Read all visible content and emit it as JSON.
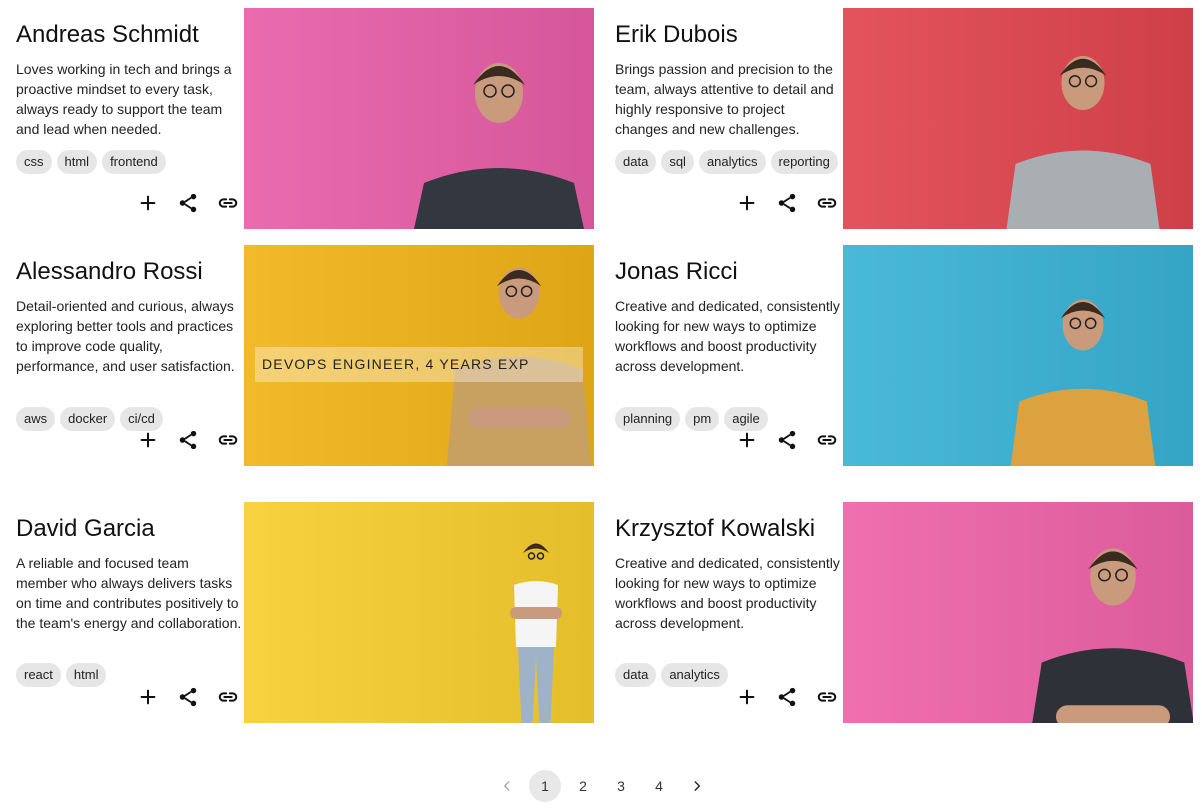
{
  "profiles": [
    {
      "name": "Andreas Schmidt",
      "description": "Loves working in tech and brings a proactive mindset to every task, always ready to support the team and lead when needed.",
      "tags": [
        "css",
        "html",
        "frontend"
      ],
      "bg_color": "#e85fa8",
      "shirt_color": "#333840",
      "overlay": ""
    },
    {
      "name": "Erik Dubois",
      "description": "Brings passion and precision to the team, always attentive to detail and highly responsive to project changes and new challenges.",
      "tags": [
        "data",
        "sql",
        "analytics",
        "reporting"
      ],
      "bg_color": "#e0454e",
      "shirt_color": "#a9aeb3",
      "overlay": ""
    },
    {
      "name": "Alessandro Rossi",
      "description": "Detail-oriented and curious, always exploring better tools and practices to improve code quality, performance, and user satisfaction.",
      "tags": [
        "aws",
        "docker",
        "ci/cd"
      ],
      "bg_color": "#f1b418",
      "shirt_color": "#c8a060",
      "overlay": "DEVOPS ENGINEER, 4 YEARS EXP"
    },
    {
      "name": "Jonas Ricci",
      "description": "Creative and dedicated, consistently looking for new ways to optimize workflows and boost productivity across development.",
      "tags": [
        "planning",
        "pm",
        "agile"
      ],
      "bg_color": "#3ab3d6",
      "shirt_color": "#dba23f",
      "overlay": ""
    },
    {
      "name": "David Garcia",
      "description": "A reliable and focused team member who always delivers tasks on time and contributes positively to the team's energy and collaboration.",
      "tags": [
        "react",
        "html"
      ],
      "bg_color": "#f8cf2e",
      "shirt_color": "#f5f5f5",
      "overlay": ""
    },
    {
      "name": "Krzysztof Kowalski",
      "description": "Creative and dedicated, consistently looking for new ways to optimize workflows and boost productivity across development.",
      "tags": [
        "data",
        "analytics"
      ],
      "bg_color": "#ef63a8",
      "shirt_color": "#2e3238",
      "overlay": ""
    }
  ],
  "actions": {
    "add_icon": "plus-icon",
    "share_icon": "share-icon",
    "link_icon": "link-icon"
  },
  "pagination": {
    "prev_icon": "chevron-left-icon",
    "pages": [
      "1",
      "2",
      "3",
      "4"
    ],
    "active_page": "1",
    "next_icon": "chevron-right-icon"
  }
}
